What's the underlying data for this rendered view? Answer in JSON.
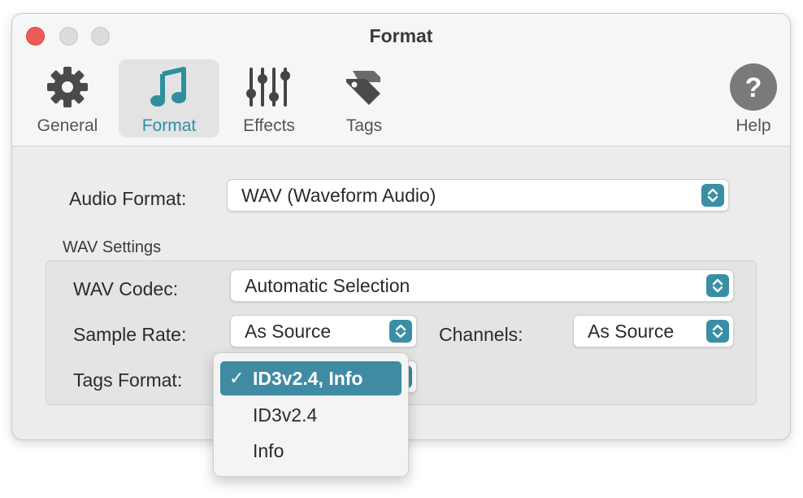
{
  "window": {
    "title": "Format"
  },
  "toolbar": {
    "tabs": [
      {
        "label": "General",
        "icon": "gear-icon"
      },
      {
        "label": "Format",
        "icon": "music-note-icon",
        "selected": true
      },
      {
        "label": "Effects",
        "icon": "sliders-icon"
      },
      {
        "label": "Tags",
        "icon": "tag-icon"
      }
    ],
    "help": {
      "label": "Help",
      "icon": "question-mark-icon"
    }
  },
  "form": {
    "audio_format": {
      "label": "Audio Format:",
      "value": "WAV (Waveform Audio)"
    },
    "group_title": "WAV Settings",
    "wav_codec": {
      "label": "WAV Codec:",
      "value": "Automatic Selection"
    },
    "sample_rate": {
      "label": "Sample Rate:",
      "value": "As Source"
    },
    "channels": {
      "label": "Channels:",
      "value": "As Source"
    },
    "tags_format": {
      "label": "Tags Format:"
    }
  },
  "tags_menu": {
    "options": [
      {
        "label": "ID3v2.4, Info",
        "checked": true,
        "check_mark": "✓"
      },
      {
        "label": "ID3v2.4",
        "checked": false
      },
      {
        "label": "Info",
        "checked": false
      }
    ]
  },
  "colors": {
    "accent": "#3a8ea6",
    "selected_tab_label": "#2e8fa6",
    "close_button": "#ee5b57"
  }
}
